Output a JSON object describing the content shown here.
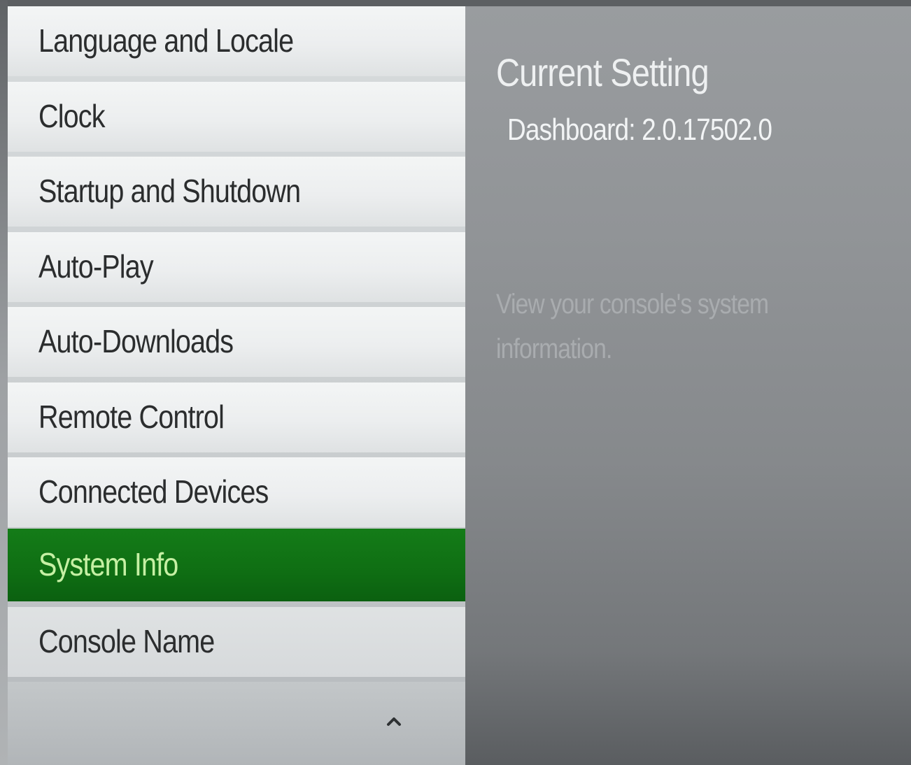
{
  "menu": {
    "items": [
      {
        "label": "Language and Locale",
        "selected": false
      },
      {
        "label": "Clock",
        "selected": false
      },
      {
        "label": "Startup and Shutdown",
        "selected": false
      },
      {
        "label": "Auto-Play",
        "selected": false
      },
      {
        "label": "Auto-Downloads",
        "selected": false
      },
      {
        "label": "Remote Control",
        "selected": false
      },
      {
        "label": "Connected Devices",
        "selected": false
      },
      {
        "label": "System Info",
        "selected": true
      },
      {
        "label": "Console Name",
        "selected": false
      }
    ],
    "scroll_up_icon": "chevron-up-icon"
  },
  "detail": {
    "title": "Current Setting",
    "value": "Dashboard: 2.0.17502.0",
    "description": "View your console's system information."
  },
  "colors": {
    "selected_background": "#107c10",
    "selected_text": "#c6f0a4",
    "item_background": "#eceeef",
    "item_text": "#2b2d2e",
    "panel_background": "#8e9194",
    "title_text": "#eef0f1",
    "description_text": "#a9acaf"
  }
}
